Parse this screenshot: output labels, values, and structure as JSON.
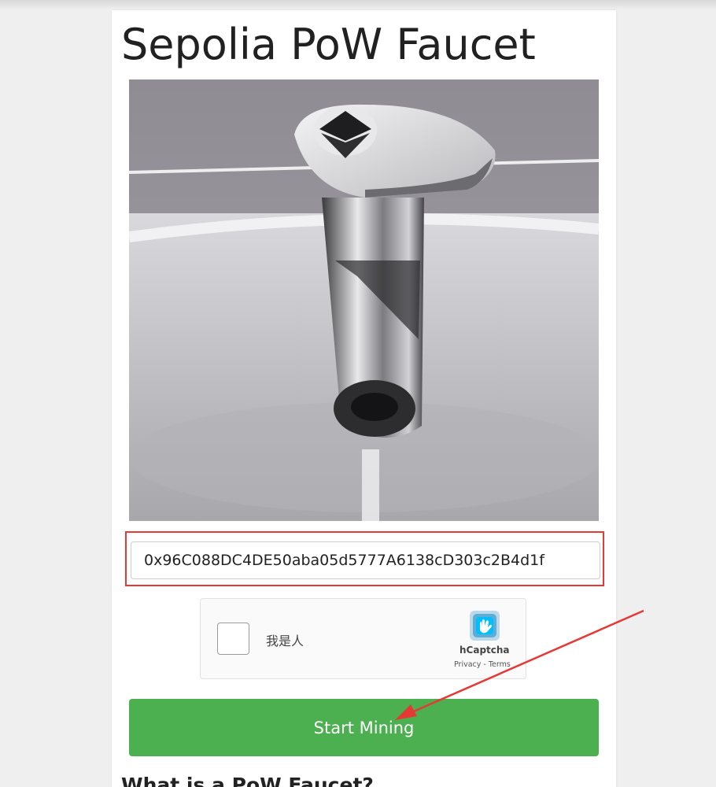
{
  "page": {
    "title": "Sepolia PoW Faucet",
    "section_heading": "What is a PoW Faucet?"
  },
  "form": {
    "address_value": "0x96C088DC4DE50aba05d5777A6138cD303c2B4d1f",
    "start_label": "Start Mining"
  },
  "captcha": {
    "label": "我是人",
    "brand": "hCaptcha",
    "links": "Privacy - Terms"
  },
  "hero_image": {
    "icon": "faucet-with-ethereum-logo"
  },
  "colors": {
    "button": "#4caf50",
    "highlight_box": "#e53935",
    "arrow": "#e53935"
  }
}
